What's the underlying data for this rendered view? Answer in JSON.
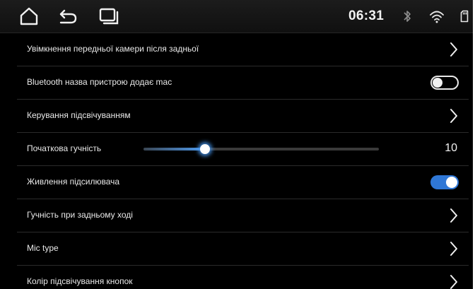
{
  "status_bar": {
    "time": "06:31",
    "icons": [
      "home-icon",
      "back-icon",
      "recent-apps-icon",
      "bluetooth-icon",
      "wifi-icon",
      "sd-card-icon"
    ]
  },
  "settings": [
    {
      "label": "Увімкнення передньої камери після задньої",
      "control": "chevron"
    },
    {
      "label": "Bluetooth назва пристрою додає mac",
      "control": "toggle",
      "enabled": false
    },
    {
      "label": "Керування підсвічуванням",
      "control": "chevron"
    },
    {
      "label": "Початкова гучність",
      "control": "slider",
      "value": "10",
      "fraction": 0.26
    },
    {
      "label": "Живлення підсилювача",
      "control": "toggle",
      "enabled": true
    },
    {
      "label": "Гучність при задньому ході",
      "control": "chevron"
    },
    {
      "label": "Mic type",
      "control": "chevron"
    },
    {
      "label": "Колір підсвічування кнопок",
      "control": "chevron"
    }
  ],
  "colors": {
    "accent": "#2f77d6",
    "background": "#000000",
    "text": "#e9e9e9",
    "divider": "#2b2b2b"
  }
}
